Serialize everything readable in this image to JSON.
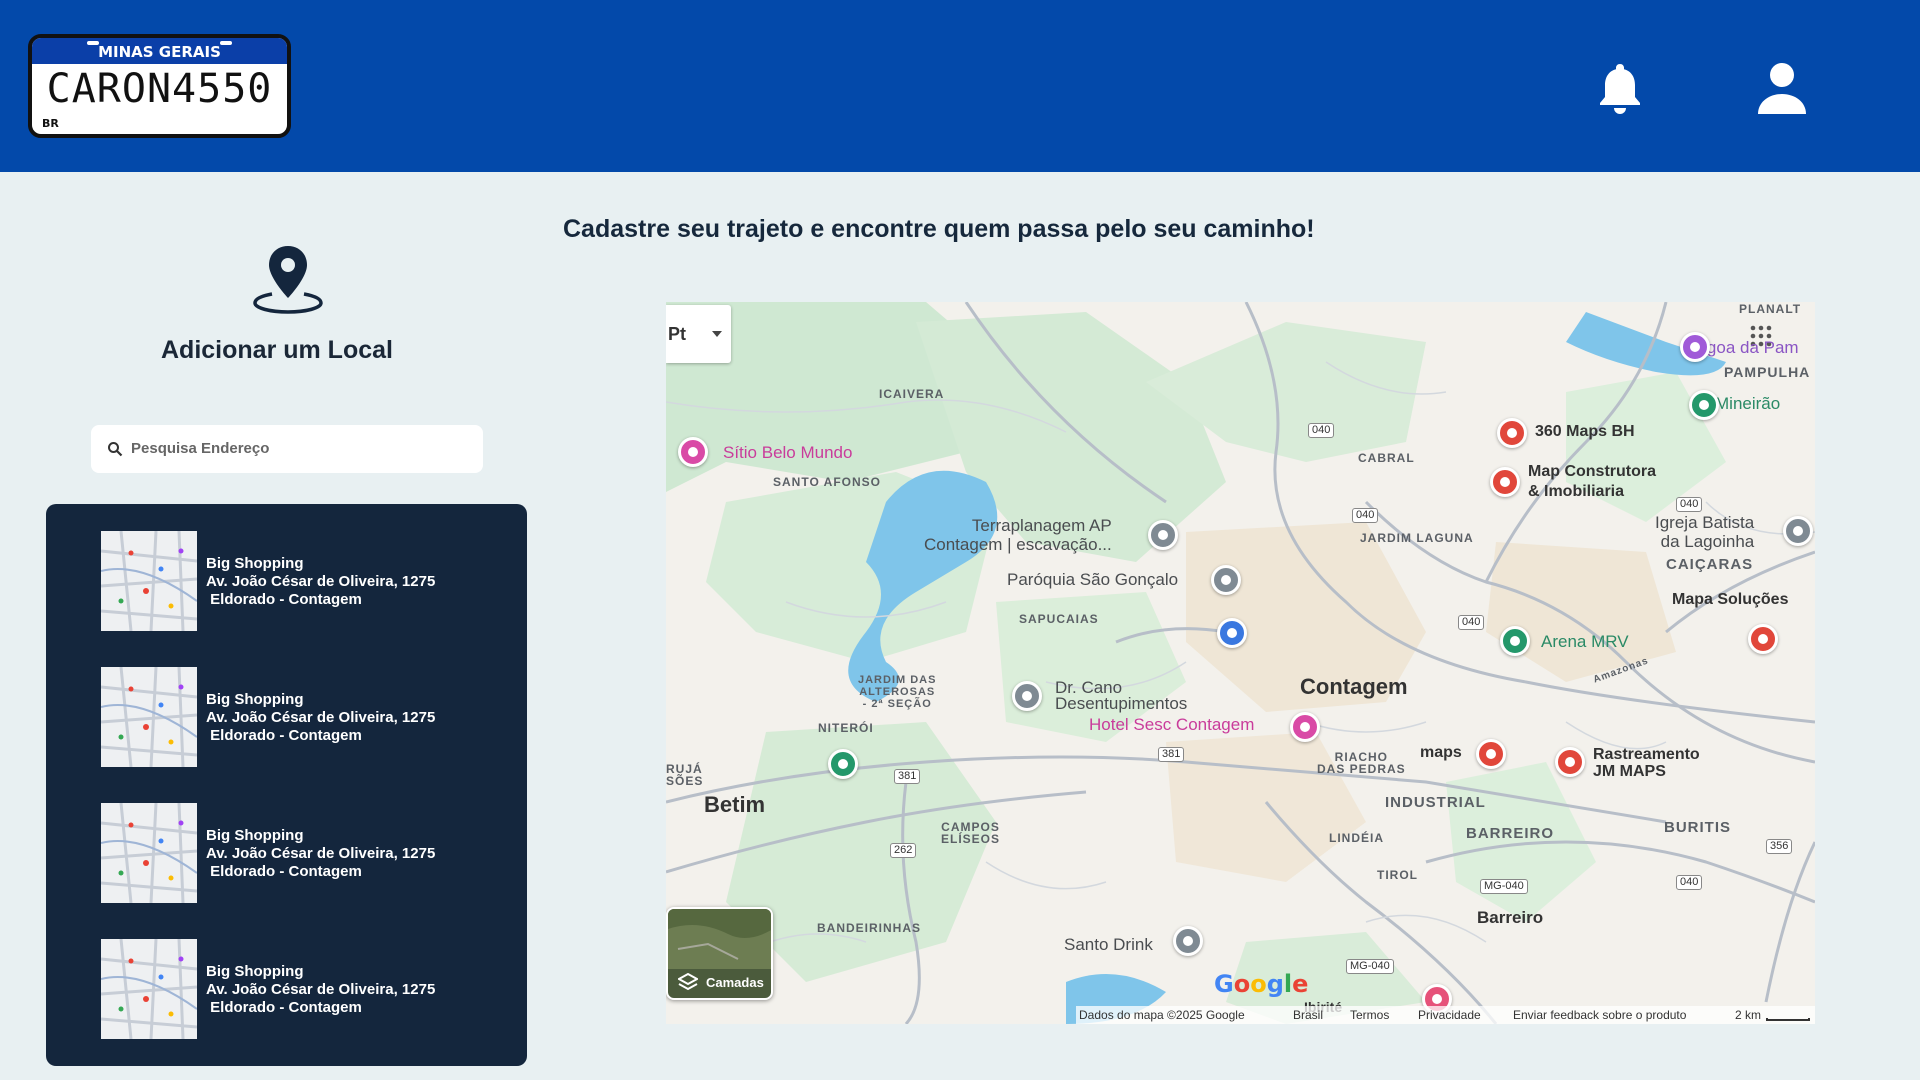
{
  "header": {
    "plate": {
      "state": "MINAS GERAIS",
      "number": "CARON4550",
      "country": "BR"
    },
    "icons": [
      "bell-icon",
      "user-icon"
    ]
  },
  "sidebar": {
    "title": "Adicionar um Local",
    "search_placeholder": "Pesquisa Endereço",
    "items": [
      {
        "name": "Big Shopping",
        "address": "Av. João César de Oliveira, 1275",
        "district": " Eldorado - Contagem"
      },
      {
        "name": "Big Shopping",
        "address": "Av. João César de Oliveira, 1275",
        "district": " Eldorado - Contagem"
      },
      {
        "name": "Big Shopping",
        "address": "Av. João César de Oliveira, 1275",
        "district": " Eldorado - Contagem"
      },
      {
        "name": "Big Shopping",
        "address": "Av. João César de Oliveira, 1275",
        "district": " Eldorado - Contagem"
      }
    ]
  },
  "main": {
    "headline": "Cadastre seu trajeto e encontre quem passa pelo seu caminho!"
  },
  "map": {
    "control_label": "Pt",
    "layers_label": "Camadas",
    "places": {
      "planalto": "PLANALT",
      "lagoa": "Lagoa da Pam",
      "pampulha": "PAMPULHA",
      "mineirao": "Mineirão",
      "icaivera": "ICAIVERA",
      "maps360": "360 Maps BH",
      "cabral": "CABRAL",
      "sitio": "Sítio Belo Mundo",
      "santo_afonso": "SANTO AFONSO",
      "map_construtora": "Map Construtora\n& Imobiliaria",
      "terraplanagem": "Terraplanagem AP\nContagem | escavação...",
      "igreja": "Igreja Batista\nda Lagoinha",
      "jardim_laguna": "JARDIM LAGUNA",
      "caicaras": "CAIÇARAS",
      "paroquia": "Paróquia São Gonçalo",
      "mapa_solucoes": "Mapa Soluções",
      "sapucaias": "SAPUCAIAS",
      "arena": "Arena MRV",
      "jardim_alterosas": "JARDIM DAS\nALTEROSAS\n- 2ª SEÇÃO",
      "dr_cano": "Dr. Cano\nDesentupimentos",
      "contagem": "Contagem",
      "hotel": "Hotel Sesc Contagem",
      "niteroi": "NITERÓI",
      "riacho": "RIACHO\nDAS PEDRAS",
      "maps": "maps",
      "rastreamento": "Rastreamento\nJM MAPS",
      "ruja_soes": "RUJÁ\nSÕES",
      "betim": "Betim",
      "industrial": "INDUSTRIAL",
      "campos": "CAMPOS\nELÍSEOS",
      "lindeia": "LINDÉIA",
      "barreiro_upper": "BARREIRO",
      "buritis": "BURITIS",
      "tirol": "TIROL",
      "bandeirinhas": "BANDEIRINHAS",
      "barreiro": "Barreiro",
      "santo_drink": "Santo Drink",
      "ibirite": "Ibirité",
      "amazonas": "Amazonas"
    },
    "roads": [
      "040",
      "040",
      "040",
      "040",
      "381",
      "381",
      "262",
      "356",
      "MG-040",
      "040",
      "MG-040"
    ],
    "footer": {
      "data": "Dados do mapa ©2025 Google",
      "brasil": "Brasil",
      "termos": "Termos",
      "privacidade": "Privacidade",
      "feedback": "Enviar feedback sobre o produto",
      "scale": "2 km"
    },
    "google_logo": "Google"
  }
}
